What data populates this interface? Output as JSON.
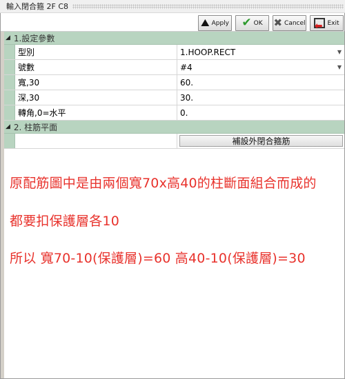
{
  "window": {
    "title": "輸入閉合箍 2F C8"
  },
  "toolbar": {
    "apply_label": "Apply",
    "ok_label": "OK",
    "cancel_label": "Cancel",
    "exit_label": "Exit"
  },
  "sections": [
    {
      "title": "1.設定參數",
      "rows": [
        {
          "label": "型別",
          "value": "1.HOOP.RECT",
          "dropdown": true
        },
        {
          "label": "號數",
          "value": "#4",
          "dropdown": true
        },
        {
          "label": "寬,30",
          "value": "60."
        },
        {
          "label": "深,30",
          "value": "30."
        },
        {
          "label": "轉角,0=水平",
          "value": "0."
        }
      ]
    },
    {
      "title": "2. 柱筋平面",
      "button_label": "補設外閉合箍筋"
    }
  ],
  "notes": [
    "原配筋圖中是由兩個寬70x高40的柱斷面組合而成的",
    "都要扣保護層各10",
    "所以 寬70-10(保護層)=60   高40-10(保護層)=30"
  ],
  "colors": {
    "section_bg": "#b8d4c0",
    "note_text": "#e8322c",
    "ok_check": "#2e9a2e",
    "exit_arrow": "#d62020"
  },
  "icons": {
    "apply": "apply-icon",
    "ok": "checkmark-icon",
    "cancel": "x-icon",
    "exit": "exit-door-icon",
    "collapse": "triangle-down-icon",
    "dropdown": "chevron-down-icon"
  }
}
